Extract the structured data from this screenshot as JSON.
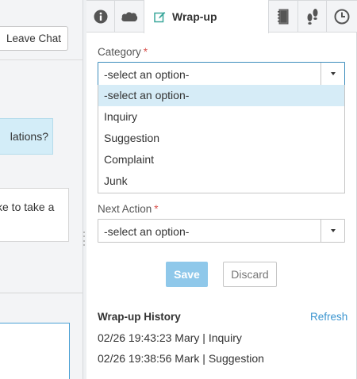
{
  "chat": {
    "leave_chat_label": "Leave Chat",
    "agent_message_fragment": "lations?",
    "customer_message_fragment": "ke to take a"
  },
  "tabs": {
    "active_label": "Wrap-up",
    "icons": [
      "info-icon",
      "salesforce-cloud-icon",
      "edit-icon",
      "notebook-icon",
      "footsteps-icon",
      "clock-icon"
    ]
  },
  "form": {
    "category_label": "Category",
    "category_value": "-select an option-",
    "category_options": [
      "-select an option-",
      "Inquiry",
      "Suggestion",
      "Complaint",
      "Junk"
    ],
    "required_mark": "*",
    "next_action_label": "Next Action",
    "next_action_value": "-select an option-",
    "save_label": "Save",
    "discard_label": "Discard"
  },
  "history": {
    "title": "Wrap-up History",
    "refresh_label": "Refresh",
    "entries": [
      "02/26 19:43:23 Mary | Inquiry",
      "02/26 19:38:56 Mark | Suggestion"
    ]
  },
  "colors": {
    "accent": "#3a94cf",
    "save_button": "#8fc8ea",
    "highlight_option": "#d6ecf7",
    "agent_bubble": "#d3edf8",
    "required": "#d9534f"
  }
}
